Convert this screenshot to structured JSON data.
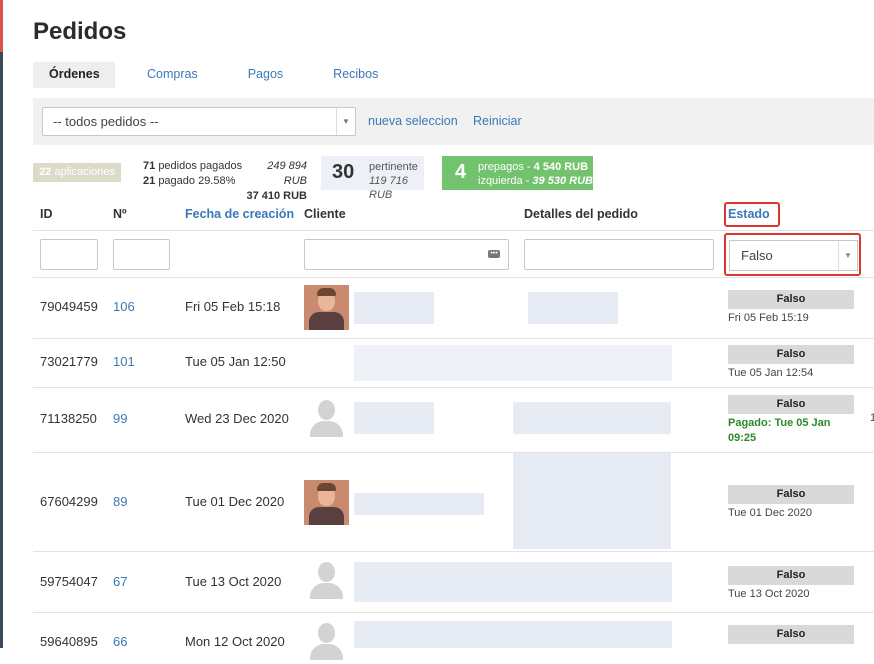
{
  "page": {
    "title": "Pedidos"
  },
  "tabs": [
    {
      "label": "Órdenes",
      "active": true
    },
    {
      "label": "Compras",
      "active": false
    },
    {
      "label": "Pagos",
      "active": false
    },
    {
      "label": "Recibos",
      "active": false
    }
  ],
  "filter": {
    "selected": "-- todos pedidos --",
    "new_selection": "nueva seleccion",
    "reset": "Reiniciar"
  },
  "stats": {
    "apps_count": "22",
    "apps_label": "aplicaciones",
    "paid_count": "71",
    "paid_label": "pedidos pagados",
    "paid_amount": "249 894 RUB",
    "paid_pct_count": "21",
    "paid_pct_label": "pagado 29.58%",
    "paid_pct_amount": "37 410 RUB",
    "relevant_count": "30",
    "relevant_label": "pertinente",
    "relevant_amount": "119 716 RUB",
    "prepaid_count": "4",
    "prepaid_label": "prepagos -",
    "prepaid_amount": "4 540 RUB",
    "left_label": "izquierda -",
    "left_amount": "39 530 RUB"
  },
  "table": {
    "headers": {
      "id": "ID",
      "num": "Nº",
      "created": "Fecha de creación",
      "client": "Cliente",
      "details": "Detalles del pedido",
      "status": "Estado"
    },
    "status_filter": "Falso",
    "rows": [
      {
        "id": "79049459",
        "num": "106",
        "date": "Fri 05 Feb 15:18",
        "avatar": "photo",
        "status": "Falso",
        "status_date": "Fri 05 Feb 15:19"
      },
      {
        "id": "73021779",
        "num": "101",
        "date": "Tue 05 Jan 12:50",
        "avatar": "none",
        "status": "Falso",
        "status_date": "Tue 05 Jan 12:54"
      },
      {
        "id": "71138250",
        "num": "99",
        "date": "Wed 23 Dec 2020",
        "avatar": "silhouette",
        "status": "Falso",
        "paid_text": "Pagado: Tue 05 Jan 09:25"
      },
      {
        "id": "67604299",
        "num": "89",
        "date": "Tue 01 Dec 2020",
        "avatar": "photo",
        "status": "Falso",
        "status_date": "Tue 01 Dec 2020"
      },
      {
        "id": "59754047",
        "num": "67",
        "date": "Tue 13 Oct 2020",
        "avatar": "silhouette",
        "status": "Falso",
        "status_date": "Tue 13 Oct 2020"
      },
      {
        "id": "59640895",
        "num": "66",
        "date": "Mon 12 Oct 2020",
        "avatar": "silhouette",
        "status": "Falso",
        "status_date": ""
      }
    ]
  },
  "edge_char": "1"
}
